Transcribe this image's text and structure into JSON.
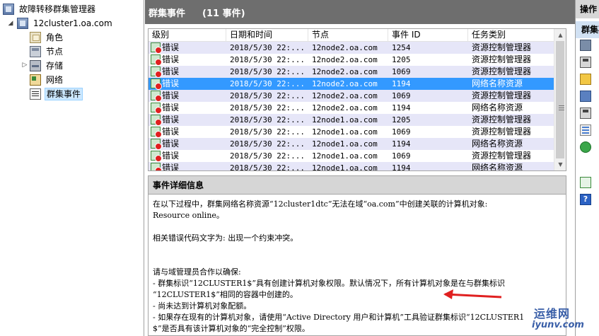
{
  "tree": {
    "root": "故障转移群集管理器",
    "cluster": "12cluster1.oa.com",
    "items": [
      {
        "label": "角色"
      },
      {
        "label": "节点"
      },
      {
        "label": "存储"
      },
      {
        "label": "网络"
      },
      {
        "label": "群集事件"
      }
    ]
  },
  "center": {
    "title": "群集事件",
    "count": "(11 事件)"
  },
  "grid": {
    "columns": [
      "级别",
      "日期和时间",
      "节点",
      "事件 ID",
      "任务类别"
    ],
    "rows": [
      {
        "level": "错误",
        "date": "2018/5/30 22:...",
        "node": "12node2.oa.com",
        "id": "1254",
        "category": "资源控制管理器"
      },
      {
        "level": "错误",
        "date": "2018/5/30 22:...",
        "node": "12node2.oa.com",
        "id": "1205",
        "category": "资源控制管理器"
      },
      {
        "level": "错误",
        "date": "2018/5/30 22:...",
        "node": "12node2.oa.com",
        "id": "1069",
        "category": "资源控制管理器"
      },
      {
        "level": "错误",
        "date": "2018/5/30 22:...",
        "node": "12node2.oa.com",
        "id": "1194",
        "category": "网络名称资源"
      },
      {
        "level": "错误",
        "date": "2018/5/30 22:...",
        "node": "12node2.oa.com",
        "id": "1069",
        "category": "资源控制管理器"
      },
      {
        "level": "错误",
        "date": "2018/5/30 22:...",
        "node": "12node2.oa.com",
        "id": "1194",
        "category": "网络名称资源"
      },
      {
        "level": "错误",
        "date": "2018/5/30 22:...",
        "node": "12node1.oa.com",
        "id": "1205",
        "category": "资源控制管理器"
      },
      {
        "level": "错误",
        "date": "2018/5/30 22:...",
        "node": "12node1.oa.com",
        "id": "1069",
        "category": "资源控制管理器"
      },
      {
        "level": "错误",
        "date": "2018/5/30 22:...",
        "node": "12node1.oa.com",
        "id": "1194",
        "category": "网络名称资源"
      },
      {
        "level": "错误",
        "date": "2018/5/30 22:...",
        "node": "12node1.oa.com",
        "id": "1069",
        "category": "资源控制管理器"
      },
      {
        "level": "错误",
        "date": "2018/5/30 22:...",
        "node": "12node1.oa.com",
        "id": "1194",
        "category": "网络名称资源"
      }
    ],
    "selected_row": 3
  },
  "details": {
    "title": "事件详细信息",
    "lines": [
      "在以下过程中，群集网络名称资源“12cluster1dtc”无法在域“oa.com”中创建关联的计算机对象:",
      "Resource online。",
      "",
      "相关错误代码文字为: 出现一个约束冲突。",
      "",
      "",
      "请与域管理员合作以确保:",
      "- 群集标识“12CLUSTER1$”具有创建计算机对象权限。默认情况下，所有计算机对象是在与群集标识",
      "“12CLUSTER1$”相同的容器中创建的。",
      "- 尚未达到计算机对象配额。",
      "- 如果存在现有的计算机对象，请使用“Active Directory 用户和计算机”工具验证群集标识“12CLUSTER1",
      "$”是否具有该计算机对象的“完全控制”权限。"
    ]
  },
  "actions": {
    "header": "操作",
    "section": "群集事件"
  },
  "watermark": {
    "text": "运维网",
    "sub": "iyunv.com"
  },
  "colors": {
    "header_bg": "#6e6e6e",
    "row_alt": "#e6e6f8",
    "row_selected": "#3399ff",
    "annotation_arrow": "#e02020"
  }
}
